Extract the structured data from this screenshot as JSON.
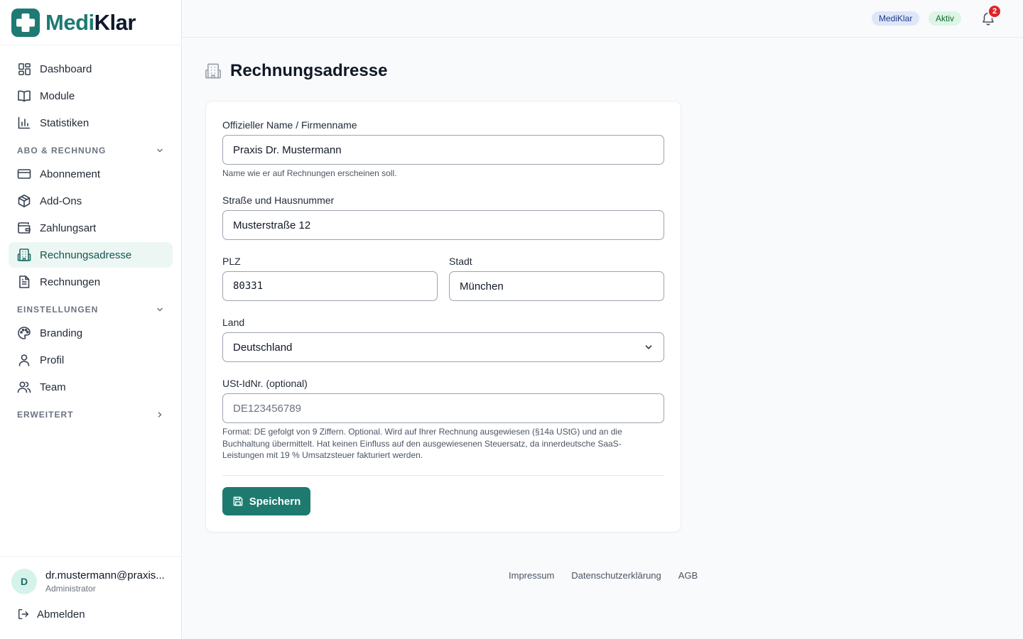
{
  "brand": {
    "name_part1": "Medi",
    "name_part2": "Klar",
    "accent": "#1e7a73"
  },
  "sidebar": {
    "items": [
      {
        "label": "Dashboard",
        "icon": "dashboard-icon"
      },
      {
        "label": "Module",
        "icon": "book-icon"
      },
      {
        "label": "Statistiken",
        "icon": "bar-chart-icon"
      }
    ],
    "sections": [
      {
        "label": "ABO & RECHNUNG",
        "expanded": true,
        "items": [
          {
            "label": "Abonnement",
            "icon": "credit-card-icon"
          },
          {
            "label": "Add-Ons",
            "icon": "package-icon"
          },
          {
            "label": "Zahlungsart",
            "icon": "wallet-icon"
          },
          {
            "label": "Rechnungsadresse",
            "icon": "building-icon",
            "active": true
          },
          {
            "label": "Rechnungen",
            "icon": "document-icon"
          }
        ]
      },
      {
        "label": "EINSTELLUNGEN",
        "expanded": true,
        "items": [
          {
            "label": "Branding",
            "icon": "palette-icon"
          },
          {
            "label": "Profil",
            "icon": "user-icon"
          },
          {
            "label": "Team",
            "icon": "users-icon"
          }
        ]
      },
      {
        "label": "ERWEITERT",
        "expanded": false,
        "items": []
      }
    ]
  },
  "user": {
    "initial": "D",
    "email": "dr.mustermann@praxis...",
    "role": "Administrator",
    "logout_label": "Abmelden"
  },
  "topbar": {
    "brand_badge": "MediKlar",
    "status_badge": "Aktiv",
    "notification_count": "2"
  },
  "page": {
    "title": "Rechnungsadresse"
  },
  "form": {
    "name": {
      "label": "Offizieller Name / Firmenname",
      "value": "Praxis Dr. Mustermann",
      "hint": "Name wie er auf Rechnungen erscheinen soll."
    },
    "street": {
      "label": "Straße und Hausnummer",
      "value": "Musterstraße 12"
    },
    "zip": {
      "label": "PLZ",
      "value": "80331"
    },
    "city": {
      "label": "Stadt",
      "value": "München"
    },
    "country": {
      "label": "Land",
      "value": "Deutschland"
    },
    "vat": {
      "label": "USt-IdNr. (optional)",
      "placeholder": "DE123456789",
      "value": "",
      "hint_line1": "Format: DE gefolgt von 9 Ziffern. Optional. Wird auf Ihrer Rechnung ausgewiesen (§14a UStG) und an die",
      "hint_line2": "Buchhaltung übermittelt. Hat keinen Einfluss auf den ausgewiesenen Steuersatz, da innerdeutsche SaaS-",
      "hint_line3": "Leistungen mit 19 % Umsatzsteuer fakturiert werden."
    },
    "save_label": "Speichern"
  },
  "footer": {
    "links": [
      "Impressum",
      "Datenschutzerklärung",
      "AGB"
    ]
  }
}
